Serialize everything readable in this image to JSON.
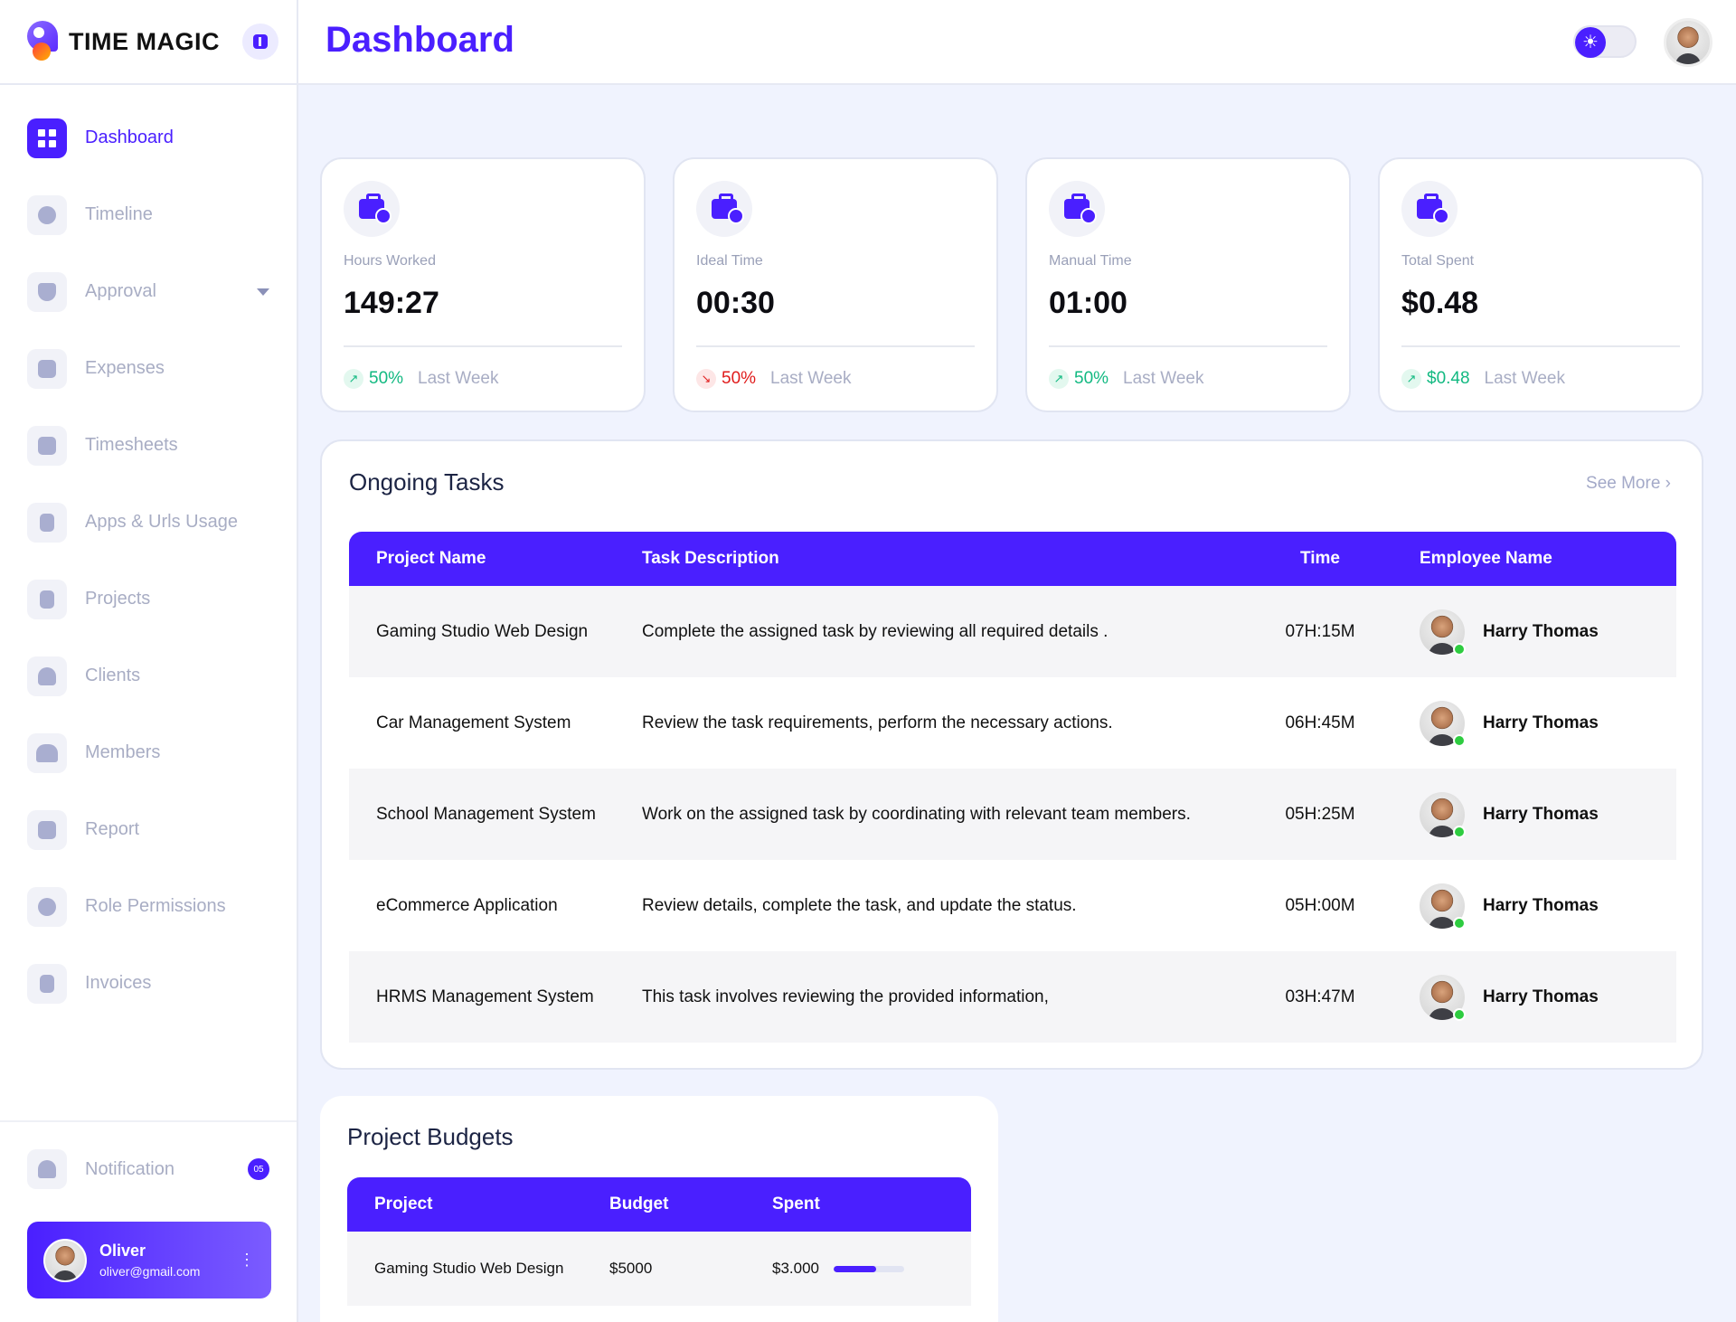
{
  "brand": {
    "name": "TIME MAGIC"
  },
  "sidebar": {
    "items": [
      {
        "label": "Dashboard",
        "icon": "dashboard-grid-icon",
        "active": true
      },
      {
        "label": "Timeline",
        "icon": "clock-icon"
      },
      {
        "label": "Approval",
        "icon": "shield-icon",
        "has_dropdown": true
      },
      {
        "label": "Expenses",
        "icon": "wallet-icon"
      },
      {
        "label": "Timesheets",
        "icon": "calendar-icon"
      },
      {
        "label": "Apps & Urls Usage",
        "icon": "file-icon"
      },
      {
        "label": "Projects",
        "icon": "document-icon"
      },
      {
        "label": "Clients",
        "icon": "user-icon"
      },
      {
        "label": "Members",
        "icon": "users-icon"
      },
      {
        "label": "Report",
        "icon": "report-icon"
      },
      {
        "label": "Role Permissions",
        "icon": "gear-icon"
      },
      {
        "label": "Invoices",
        "icon": "invoice-icon"
      }
    ],
    "notification": {
      "label": "Notification",
      "count": "05",
      "icon": "bell-icon"
    },
    "user": {
      "name": "Oliver",
      "email": "oliver@gmail.com"
    }
  },
  "header": {
    "title": "Dashboard",
    "theme_toggle_icon": "sun-icon"
  },
  "stats": [
    {
      "label": "Hours Worked",
      "value": "149:27",
      "change": "50%",
      "trend": "up",
      "period": "Last Week"
    },
    {
      "label": "Ideal Time",
      "value": "00:30",
      "change": "50%",
      "trend": "down",
      "period": "Last Week"
    },
    {
      "label": "Manual Time",
      "value": "01:00",
      "change": "50%",
      "trend": "up",
      "period": "Last Week"
    },
    {
      "label": "Total Spent",
      "value": "$0.48",
      "change": "$0.48",
      "trend": "up",
      "period": "Last Week"
    }
  ],
  "ongoing": {
    "title": "Ongoing Tasks",
    "see_more": "See More",
    "columns": [
      "Project Name",
      "Task Description",
      "Time",
      "Employee Name"
    ],
    "rows": [
      {
        "project": "Gaming Studio Web Design",
        "description": "Complete the assigned task by reviewing all required details .",
        "time": "07H:15M",
        "employee": "Harry Thomas"
      },
      {
        "project": "Car Management System",
        "description": "Review the task requirements, perform the necessary actions.",
        "time": "06H:45M",
        "employee": "Harry Thomas"
      },
      {
        "project": "School Management System",
        "description": "Work on the assigned task by coordinating with relevant team members.",
        "time": "05H:25M",
        "employee": "Harry Thomas"
      },
      {
        "project": "eCommerce Application",
        "description": "Review details, complete the task, and update the status.",
        "time": "05H:00M",
        "employee": "Harry Thomas"
      },
      {
        "project": "HRMS Management System",
        "description": "This task involves reviewing the provided information,",
        "time": "03H:47M",
        "employee": "Harry Thomas"
      }
    ]
  },
  "budgets": {
    "title": "Project Budgets",
    "columns": [
      "Project",
      "Budget",
      "Spent"
    ],
    "rows": [
      {
        "project": "Gaming Studio Web Design",
        "budget": "$5000",
        "spent": "$3.000",
        "progress": 0.6
      }
    ]
  }
}
